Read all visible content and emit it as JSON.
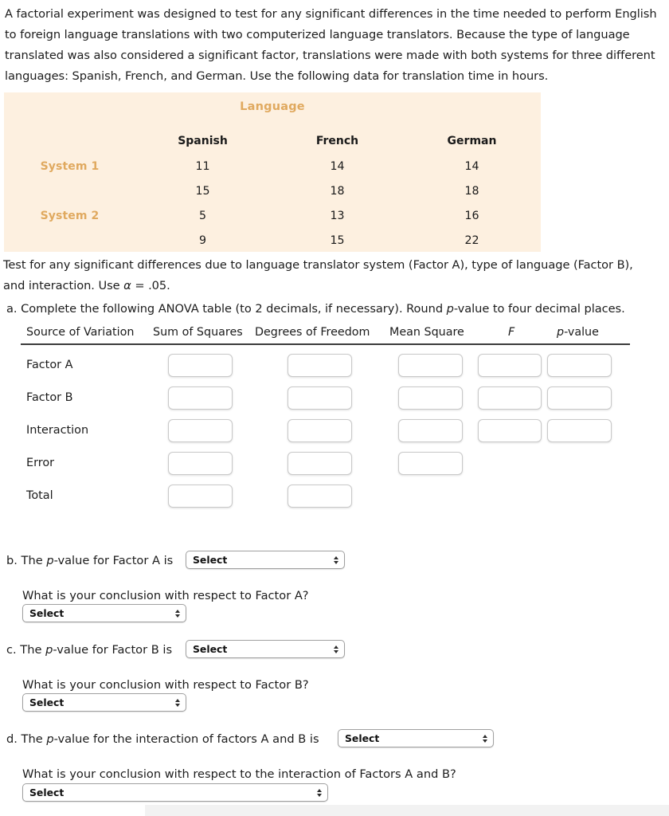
{
  "intro": {
    "text": "A factorial experiment was designed to test for any significant differences in the time needed to perform English to foreign language translations with two computerized language translators. Because the type of language translated was also considered a significant factor, translations were made with both systems for three different languages: Spanish, French, and German. Use the following data for translation time in hours."
  },
  "data_table": {
    "title": "Language",
    "accent_color": "#e0a95f",
    "panel_color": "#fdf0e0",
    "column_headers": [
      "Spanish",
      "French",
      "German"
    ],
    "rows": [
      {
        "label": "System 1",
        "values": [
          "11",
          "14",
          "14"
        ]
      },
      {
        "label": "",
        "values": [
          "15",
          "18",
          "18"
        ]
      },
      {
        "label": "System 2",
        "values": [
          "5",
          "13",
          "16"
        ]
      },
      {
        "label": "",
        "values": [
          "9",
          "15",
          "22"
        ]
      }
    ]
  },
  "test_paragraph": {
    "line1": "Test for any significant differences due to language translator system (Factor A), type of language (Factor B),",
    "line2_pre": "and interaction. Use ",
    "alpha": "α",
    "line2_post": " = .05."
  },
  "part_a": {
    "prompt_pre": "a. Complete the following ANOVA table (to 2 decimals, if necessary). Round ",
    "prompt_italic": "p",
    "prompt_post": "-value to four decimal places."
  },
  "anova": {
    "headers": {
      "source": "Source of Variation",
      "ss": "Sum of Squares",
      "df": "Degrees of Freedom",
      "ms": "Mean Square",
      "f": "F",
      "p_italic": "p",
      "p_rest": "-value"
    },
    "rows": [
      {
        "name": "Factor A",
        "fields": [
          "",
          "",
          "",
          "",
          ""
        ],
        "field_count": 5
      },
      {
        "name": "Factor B",
        "fields": [
          "",
          "",
          "",
          "",
          ""
        ],
        "field_count": 5
      },
      {
        "name": "Interaction",
        "fields": [
          "",
          "",
          "",
          "",
          ""
        ],
        "field_count": 5
      },
      {
        "name": "Error",
        "fields": [
          "",
          "",
          ""
        ],
        "field_count": 3
      },
      {
        "name": "Total",
        "fields": [
          "",
          ""
        ],
        "field_count": 2
      }
    ]
  },
  "part_b": {
    "label_pre": "b. The ",
    "label_italic": "p",
    "label_post": "-value for Factor A is",
    "select_value": "Select",
    "conclusion_question": "What is your conclusion with respect to Factor A?",
    "conclusion_select_value": "Select"
  },
  "part_c": {
    "label_pre": "c. The ",
    "label_italic": "p",
    "label_post": "-value for Factor B is",
    "select_value": "Select",
    "conclusion_question": "What is your conclusion with respect to Factor B?",
    "conclusion_select_value": "Select"
  },
  "part_d": {
    "label_pre": "d. The ",
    "label_italic": "p",
    "label_post": "-value for the interaction of factors A and B is",
    "select_value": "Select",
    "conclusion_question": "What is your conclusion with respect to the interaction of Factors A and B?",
    "conclusion_select_value": "Select"
  }
}
